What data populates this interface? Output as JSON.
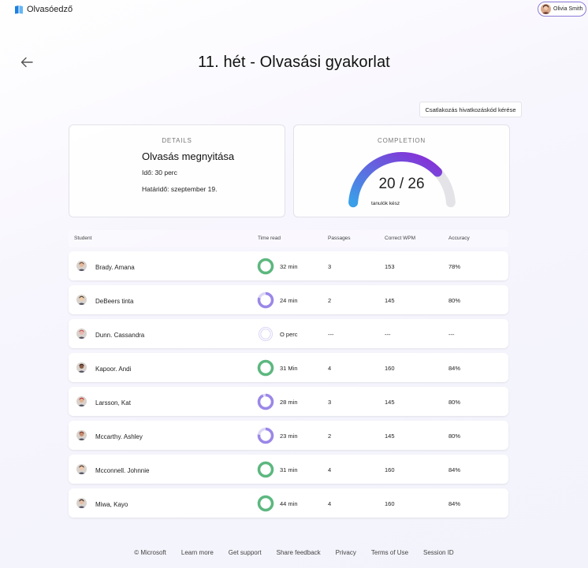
{
  "app": {
    "name": "Olvasóedző"
  },
  "user": {
    "name": "Olivia Smith"
  },
  "page": {
    "title": "11. hét - Olvasási gyakorlat"
  },
  "toolbar": {
    "join_code_label": "Csatlakozás hivatkozáskód kérése"
  },
  "details": {
    "caption": "DETAILS",
    "title": "Olvasás megnyitása",
    "duration": "Idő: 30 perc",
    "due": "Határidő: szeptember 19."
  },
  "completion": {
    "caption": "COMPLETION",
    "value_text": "20 / 26",
    "done": 20,
    "total": 26,
    "label": "tanulók kész"
  },
  "table": {
    "headers": {
      "student": "Student",
      "time_read": "Time read",
      "passages": "Passages",
      "wpm": "Correct WPM",
      "accuracy": "Accuracy"
    },
    "rows": [
      {
        "name": "Brady. Amana",
        "time": "32 min",
        "time_progress": 1.0,
        "passages": "3",
        "wpm": "153",
        "accuracy": "78%"
      },
      {
        "name": "DeBeers tinta",
        "time": "24 min",
        "time_progress": 0.8,
        "passages": "2",
        "wpm": "145",
        "accuracy": "80%"
      },
      {
        "name": "Dunn. Cassandra",
        "time": "O perc",
        "time_progress": 0.0,
        "passages": "---",
        "wpm": "---",
        "accuracy": "---"
      },
      {
        "name": "Kapoor. Andi",
        "time": "31 Min",
        "time_progress": 1.0,
        "passages": "4",
        "wpm": "160",
        "accuracy": "84%"
      },
      {
        "name": "Larsson, Kat",
        "time": "28 min",
        "time_progress": 0.93,
        "passages": "3",
        "wpm": "145",
        "accuracy": "80%"
      },
      {
        "name": "Mccarthy. Ashley",
        "time": "23 min",
        "time_progress": 0.77,
        "passages": "2",
        "wpm": "145",
        "accuracy": "80%"
      },
      {
        "name": "Mcconnell. Johnnie",
        "time": "31 min",
        "time_progress": 1.0,
        "passages": "4",
        "wpm": "160",
        "accuracy": "84%"
      },
      {
        "name": "Miwa, Kayo",
        "time": "44 min",
        "time_progress": 1.0,
        "passages": "4",
        "wpm": "160",
        "accuracy": "84%"
      }
    ]
  },
  "footer": {
    "copyright": "© Microsoft",
    "learn_more": "Learn more",
    "support": "Get support",
    "feedback": "Share feedback",
    "privacy": "Privacy",
    "terms": "Terms of Use",
    "session": "Session ID"
  },
  "colors": {
    "ring_complete": "#5cb87e",
    "ring_partial": "#9b87e8",
    "ring_track": "#dcd6f5",
    "gauge_start": "#3a9fe8",
    "gauge_end": "#8a2bd6",
    "gauge_track": "#e4e4e8"
  },
  "icons": {
    "back": "arrow-left-icon",
    "logo": "book-icon"
  }
}
